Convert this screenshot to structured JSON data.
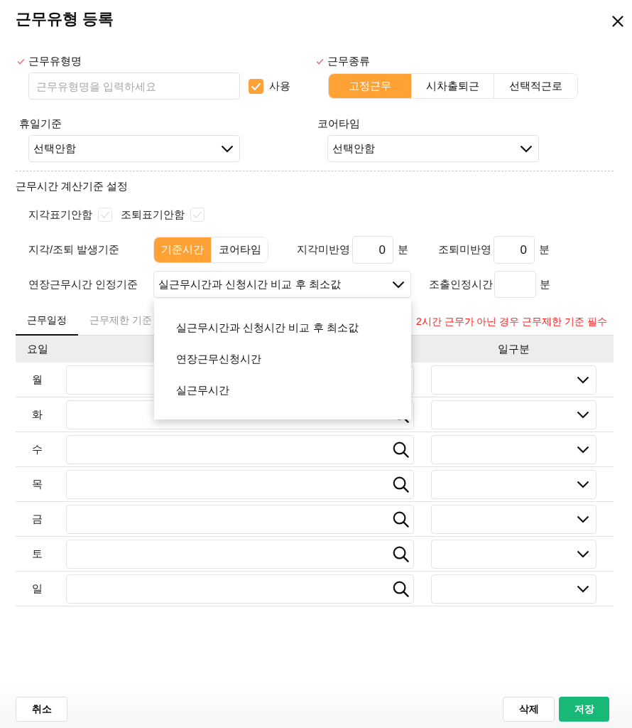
{
  "dialog": {
    "title": "근무유형 등록"
  },
  "basic": {
    "name_field": {
      "label": "근무유형명",
      "required": true,
      "placeholder": "근무유형명을 입력하세요"
    },
    "use_checkbox": {
      "label": "사용",
      "checked": true
    },
    "work_kind": {
      "label": "근무종류",
      "required": true,
      "options": [
        {
          "label": "고정근무",
          "selected": true
        },
        {
          "label": "시차출퇴근",
          "selected": false
        },
        {
          "label": "선택적근로",
          "selected": false
        }
      ]
    },
    "holiday_basis": {
      "label": "휴일기준",
      "value": "선택안함"
    },
    "core_time": {
      "label": "코어타임",
      "value": "선택안함"
    }
  },
  "calc_settings": {
    "title": "근무시간 계산기준 설정",
    "flags": [
      {
        "label": "지각표기안함",
        "checked": false
      },
      {
        "label": "조퇴표기안함",
        "checked": false
      }
    ],
    "late_early_basis": {
      "label": "지각/조퇴 발생기준",
      "options": [
        {
          "label": "기준시간",
          "selected": true
        },
        {
          "label": "코어타임",
          "selected": false
        }
      ]
    },
    "minute_fields": [
      {
        "label": "지각미반영",
        "value": "0",
        "unit": "분"
      },
      {
        "label": "조퇴미반영",
        "value": "0",
        "unit": "분"
      }
    ],
    "overtime_basis": {
      "label": "연장근무시간 인정기준",
      "value": "실근무시간과 신청시간 비교 후 최소값",
      "open": true,
      "options": [
        "실근무시간과 신청시간 비교 후 최소값",
        "연장근무신청시간",
        "실근무시간"
      ]
    },
    "early_arrival": {
      "label": "조출인정시간",
      "unit": "분"
    }
  },
  "tabs": [
    {
      "label": "근무일정",
      "selected": true
    },
    {
      "label": "근무제한 기준",
      "selected": false
    }
  ],
  "notice": "2시간 근무가 아닌 경우 근무제한 기준 필수",
  "schedule": {
    "columns": [
      "요일",
      "일구분"
    ],
    "rows": [
      {
        "day": "월"
      },
      {
        "day": "화"
      },
      {
        "day": "수"
      },
      {
        "day": "목"
      },
      {
        "day": "금"
      },
      {
        "day": "토"
      },
      {
        "day": "일"
      }
    ]
  },
  "footer": {
    "left_buttons": [
      {
        "label": "취소",
        "kind": "cancel"
      }
    ],
    "right_buttons": [
      {
        "label": "삭제",
        "kind": "delete"
      },
      {
        "label": "저장",
        "kind": "save"
      }
    ]
  }
}
